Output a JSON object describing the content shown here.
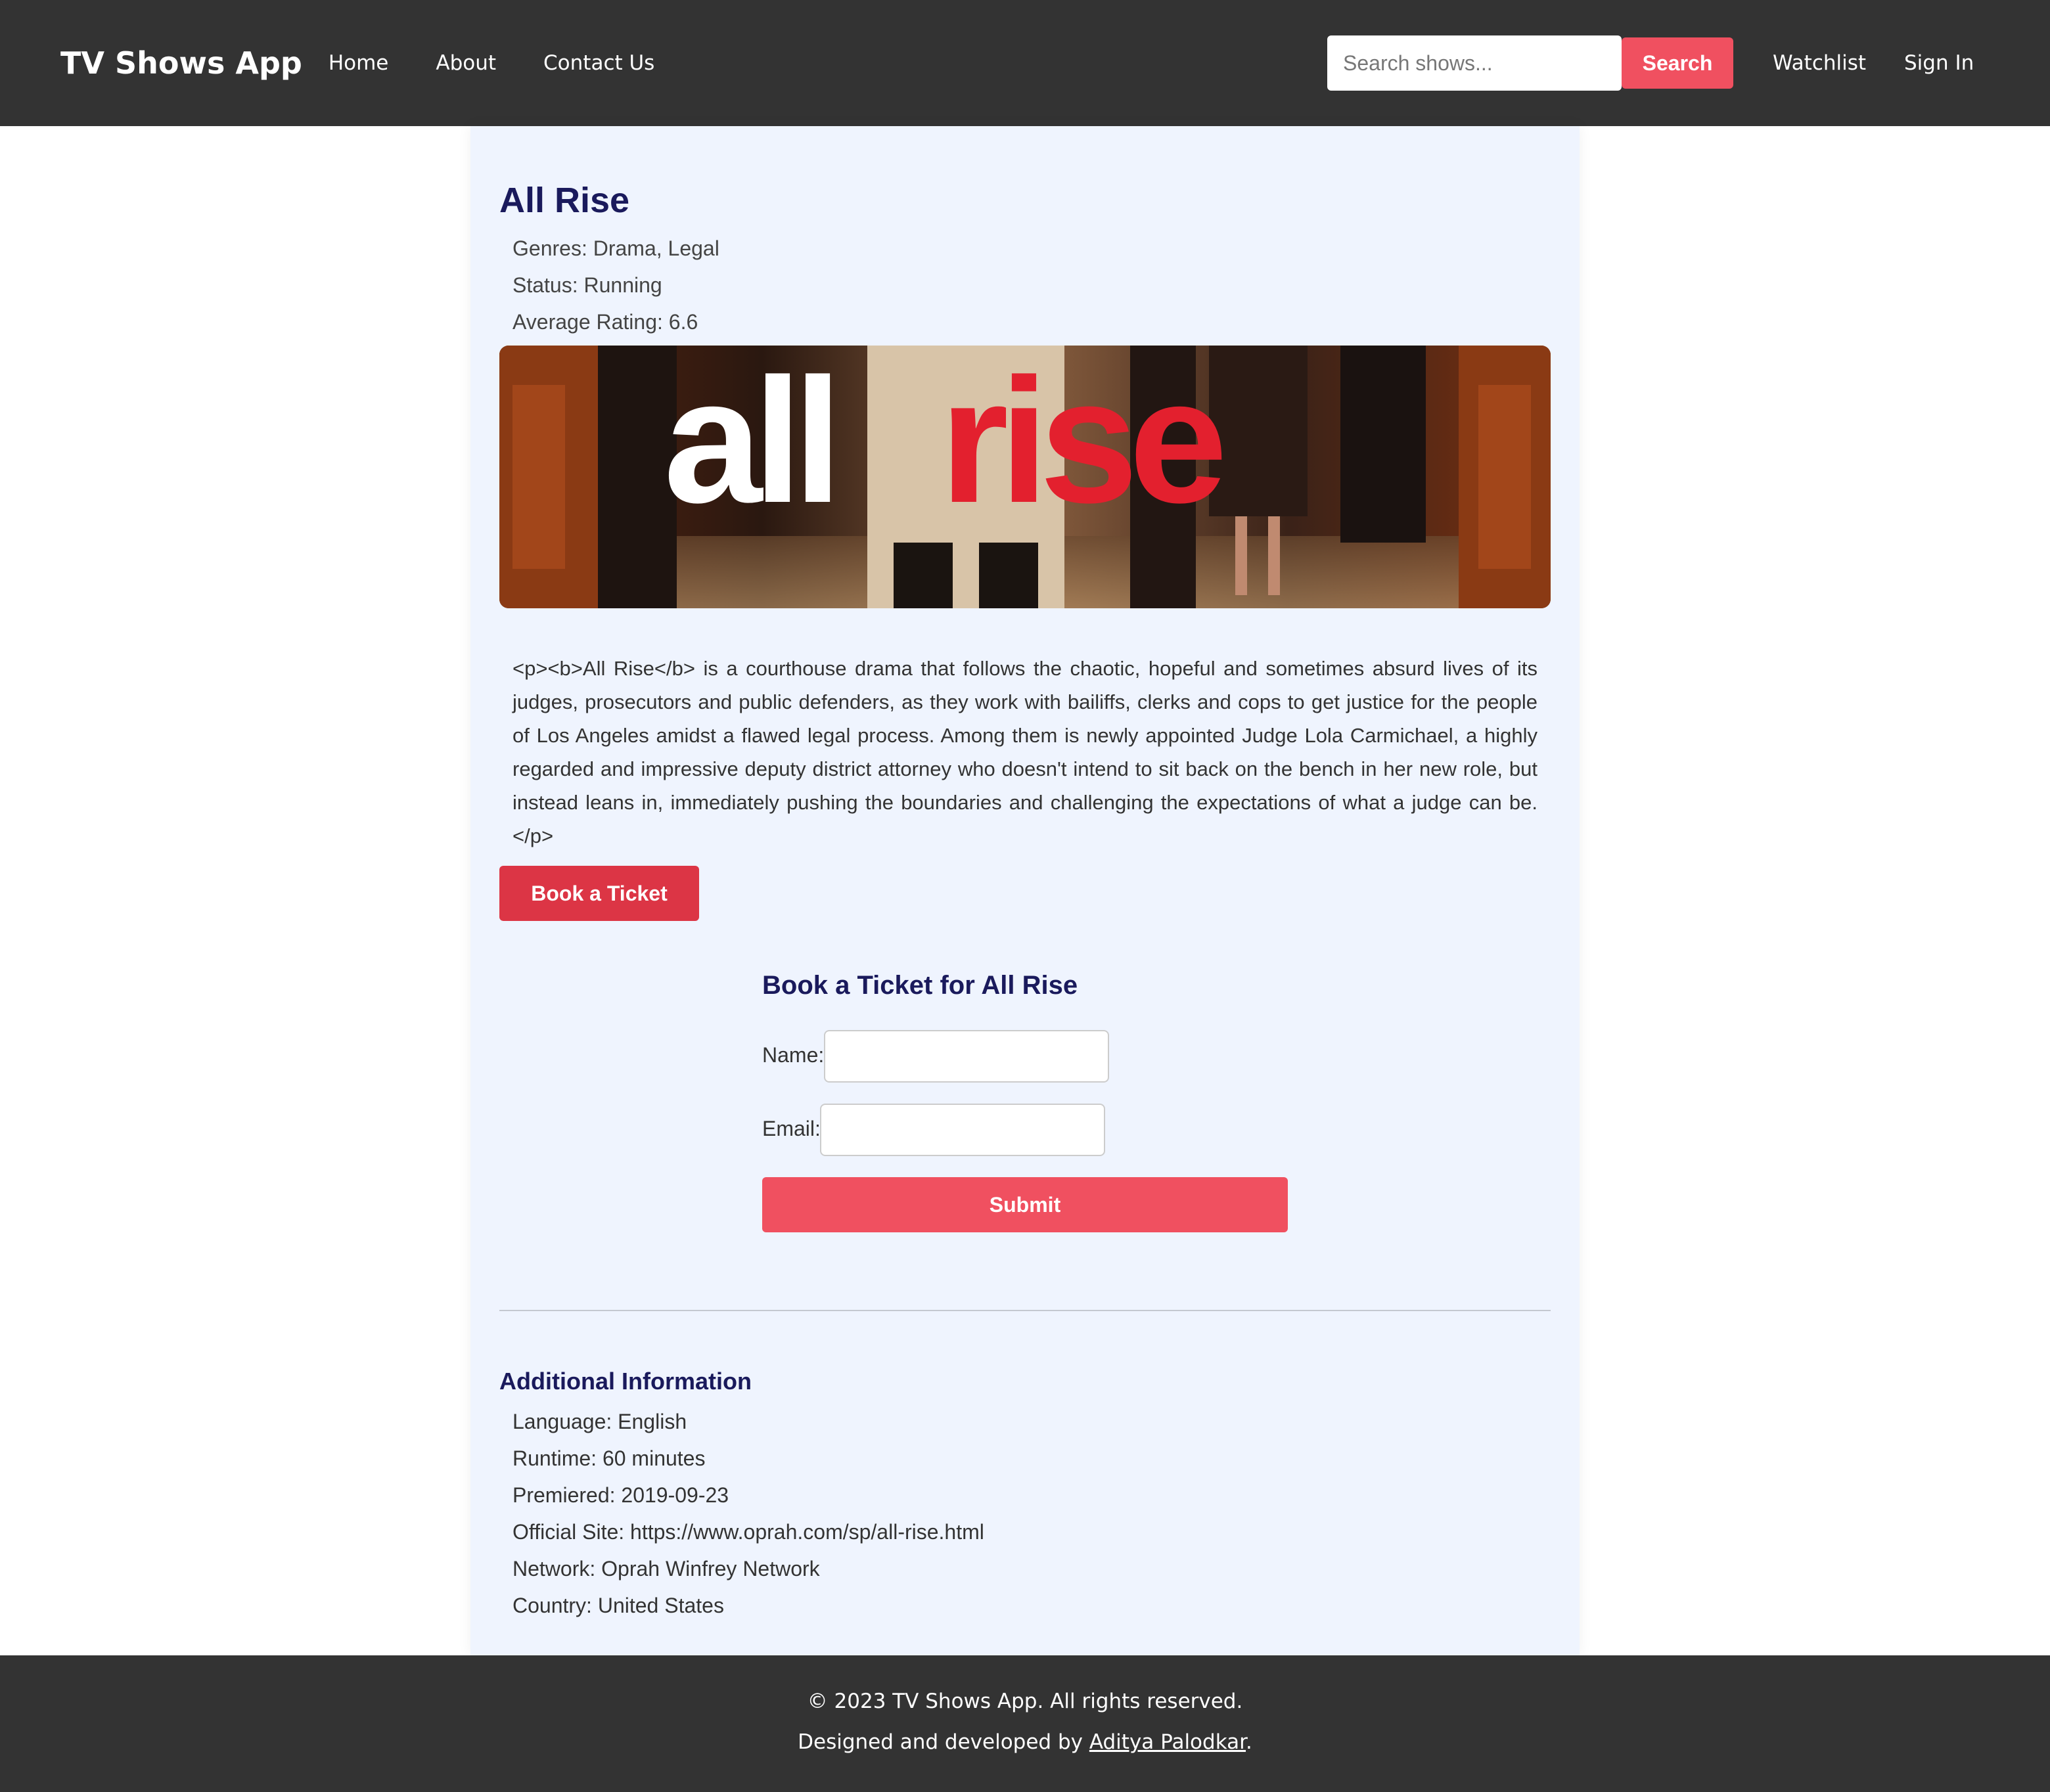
{
  "header": {
    "brand": "TV Shows App",
    "nav": [
      "Home",
      "About",
      "Contact Us"
    ],
    "search": {
      "placeholder": "Search shows...",
      "value": "",
      "button_label": "Search"
    },
    "right_links": [
      "Watchlist",
      "Sign In"
    ]
  },
  "show": {
    "title": "All Rise",
    "genres": "Genres: Drama, Legal",
    "status": "Status: Running",
    "rating": "Average Rating: 6.6",
    "banner_logo": {
      "part1": "all",
      "part2": "rise"
    },
    "summary": "<p><b>All Rise</b> is a courthouse drama that follows the chaotic, hopeful and sometimes absurd lives of its judges, prosecutors and public defenders, as they work with bailiffs, clerks and cops to get justice for the people of Los Angeles amidst a flawed legal process. Among them is newly appointed Judge Lola Carmichael, a highly regarded and impressive deputy district attorney who doesn't intend to sit back on the bench in her new role, but instead leans in, immediately pushing the boundaries and challenging the expectations of what a judge can be.</p>",
    "book_button": "Book a Ticket"
  },
  "booking_form": {
    "title": "Book a Ticket for All Rise",
    "name_label": "Name:",
    "name_value": "",
    "email_label": "Email:",
    "email_value": "",
    "submit_label": "Submit"
  },
  "additional_info": {
    "title": "Additional Information",
    "lines": [
      "Language: English",
      "Runtime: 60 minutes",
      "Premiered: 2019-09-23",
      "Official Site: https://www.oprah.com/sp/all-rise.html",
      "Network: Oprah Winfrey Network",
      "Country: United States"
    ]
  },
  "footer": {
    "copyright": "© 2023 TV Shows App. All rights reserved.",
    "credit_prefix": "Designed and developed by ",
    "credit_name": "Aditya Palodkar",
    "credit_suffix": "."
  },
  "colors": {
    "header_bg": "#333333",
    "accent": "#f05060",
    "book_button": "#dc3545",
    "title": "#1a1a5c",
    "card_bg": "#eff4fe"
  }
}
